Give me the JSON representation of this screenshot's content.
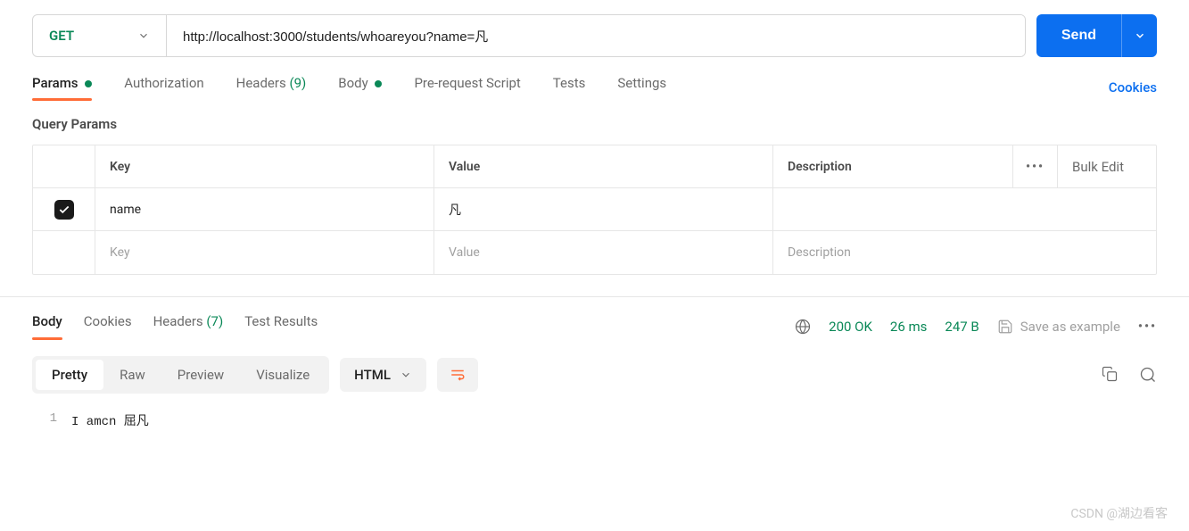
{
  "request": {
    "method": "GET",
    "url": "http://localhost:3000/students/whoareyou?name=凡",
    "send_label": "Send"
  },
  "tabs": {
    "params": "Params",
    "authorization": "Authorization",
    "headers": "Headers",
    "headers_count": "(9)",
    "body": "Body",
    "prerequest": "Pre-request Script",
    "tests": "Tests",
    "settings": "Settings",
    "cookies": "Cookies"
  },
  "section": {
    "query_params": "Query Params"
  },
  "table": {
    "key_header": "Key",
    "value_header": "Value",
    "desc_header": "Description",
    "bulk_edit": "Bulk Edit",
    "key_placeholder": "Key",
    "value_placeholder": "Value",
    "desc_placeholder": "Description",
    "rows": [
      {
        "checked": true,
        "key": "name",
        "value": "凡",
        "description": ""
      }
    ]
  },
  "response": {
    "body_tab": "Body",
    "cookies_tab": "Cookies",
    "headers_tab": "Headers",
    "headers_count": "(7)",
    "test_results_tab": "Test Results",
    "status": "200 OK",
    "time": "26 ms",
    "size": "247 B",
    "save_example": "Save as example"
  },
  "viewer": {
    "pretty": "Pretty",
    "raw": "Raw",
    "preview": "Preview",
    "visualize": "Visualize",
    "format": "HTML"
  },
  "code": {
    "line_num": "1",
    "content": "I amcn 屈凡"
  },
  "watermark": "CSDN @湖边看客"
}
